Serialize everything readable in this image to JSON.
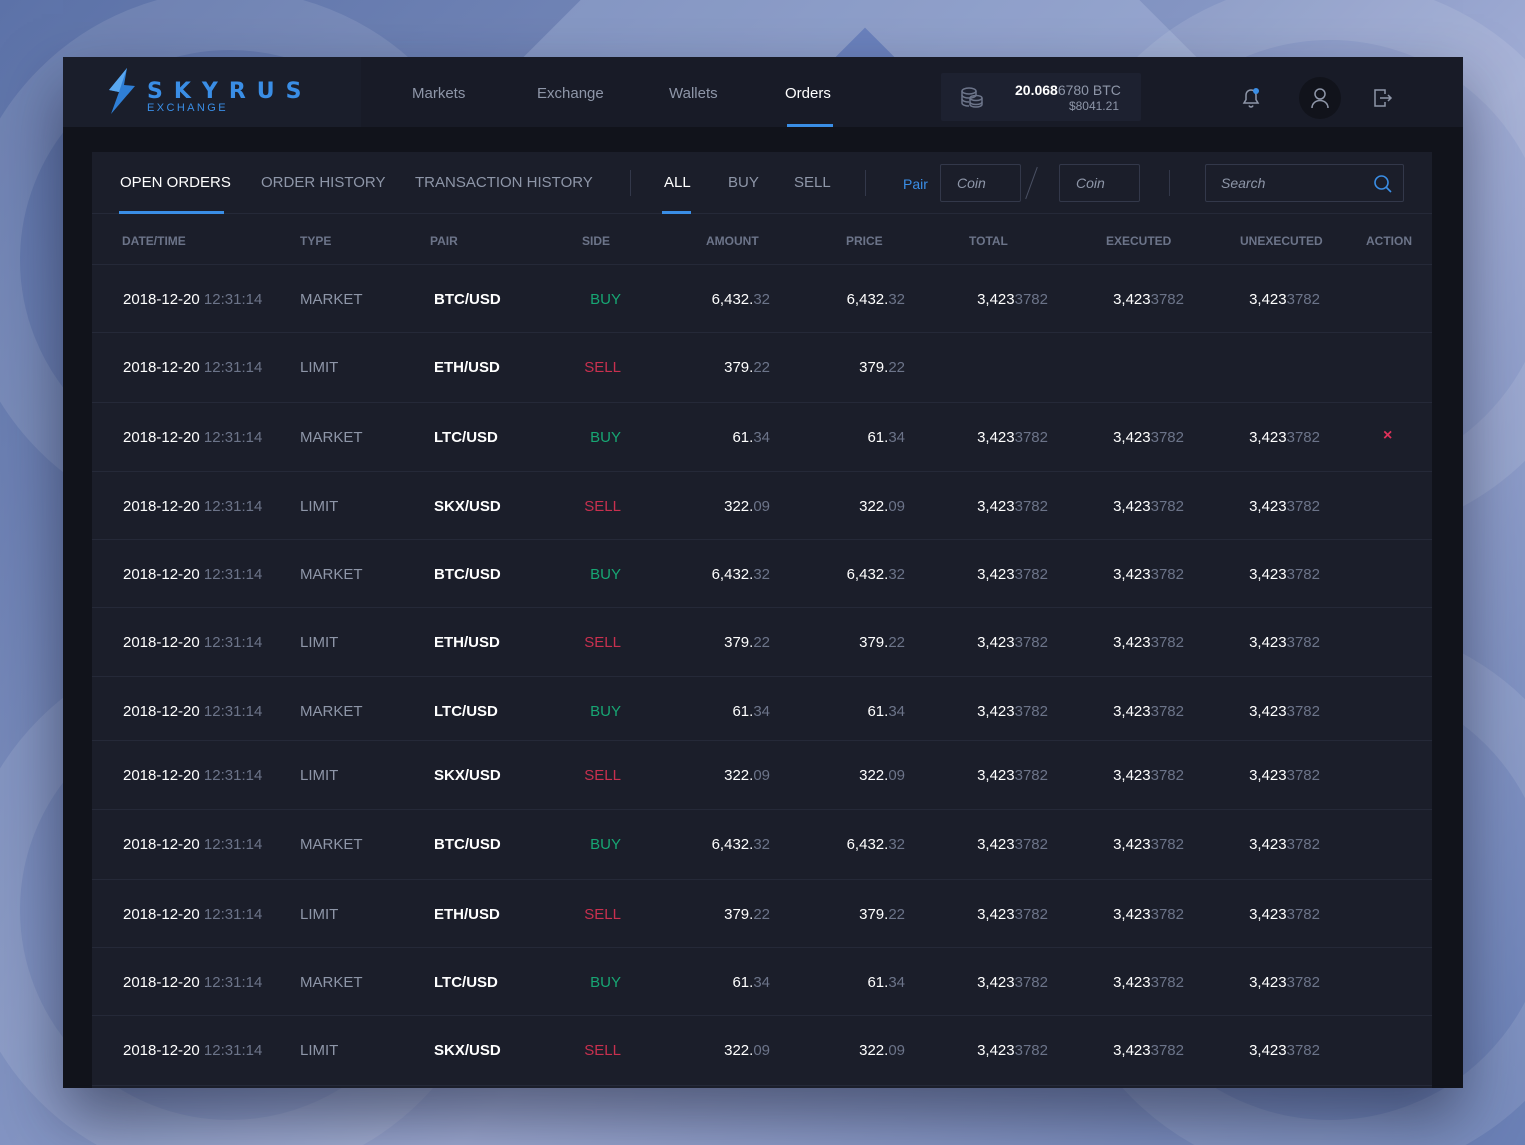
{
  "brand": {
    "name": "SKYRUS",
    "subtitle": "EXCHANGE"
  },
  "nav": [
    "Markets",
    "Exchange",
    "Wallets",
    "Orders"
  ],
  "nav_active": "Orders",
  "balance": {
    "btc_main": "20.068",
    "btc_decimals": "6780",
    "btc_unit": "BTC",
    "usd": "$8041.21"
  },
  "tabs": [
    "OPEN ORDERS",
    "ORDER HISTORY",
    "TRANSACTION HISTORY"
  ],
  "tab_active": "OPEN ORDERS",
  "side_filters": [
    "ALL",
    "BUY",
    "SELL"
  ],
  "side_filter_active": "ALL",
  "pair_filter": {
    "label": "Pair",
    "coin1_placeholder": "Coin",
    "coin2_placeholder": "Coin"
  },
  "search": {
    "placeholder": "Search"
  },
  "columns": [
    "DATE/TIME",
    "TYPE",
    "PAIR",
    "SIDE",
    "AMOUNT",
    "PRICE",
    "TOTAL",
    "EXECUTED",
    "UNEXECUTED",
    "ACTION"
  ],
  "colors": {
    "accent": "#3a8ee6",
    "buy": "#17a673",
    "sell": "#c8304f",
    "cancel": "#e0315a"
  },
  "rows": [
    {
      "date": "2018-12-20",
      "time": "12:31:14",
      "type": "MARKET",
      "pair": "BTC/USD",
      "side": "BUY",
      "amount_int": "6,432.",
      "amount_frac": "32",
      "price_int": "6,432.",
      "price_frac": "32",
      "total_int": "3,423",
      "total_frac": "3782",
      "exec_int": "3,423",
      "exec_frac": "3782",
      "unexec_int": "3,423",
      "unexec_frac": "3782",
      "action": ""
    },
    {
      "date": "2018-12-20",
      "time": "12:31:14",
      "type": "LIMIT",
      "pair": "ETH/USD",
      "side": "SELL",
      "amount_int": "379.",
      "amount_frac": "22",
      "price_int": "379.",
      "price_frac": "22",
      "total_int": "",
      "total_frac": "",
      "exec_int": "",
      "exec_frac": "",
      "unexec_int": "",
      "unexec_frac": "",
      "action": ""
    },
    {
      "date": "2018-12-20",
      "time": "12:31:14",
      "type": "MARKET",
      "pair": "LTC/USD",
      "side": "BUY",
      "amount_int": "61.",
      "amount_frac": "34",
      "price_int": "61.",
      "price_frac": "34",
      "total_int": "3,423",
      "total_frac": "3782",
      "exec_int": "3,423",
      "exec_frac": "3782",
      "unexec_int": "3,423",
      "unexec_frac": "3782",
      "action": "×"
    },
    {
      "date": "2018-12-20",
      "time": "12:31:14",
      "type": "LIMIT",
      "pair": "SKX/USD",
      "side": "SELL",
      "amount_int": "322.",
      "amount_frac": "09",
      "price_int": "322.",
      "price_frac": "09",
      "total_int": "3,423",
      "total_frac": "3782",
      "exec_int": "3,423",
      "exec_frac": "3782",
      "unexec_int": "3,423",
      "unexec_frac": "3782",
      "action": ""
    },
    {
      "date": "2018-12-20",
      "time": "12:31:14",
      "type": "MARKET",
      "pair": "BTC/USD",
      "side": "BUY",
      "amount_int": "6,432.",
      "amount_frac": "32",
      "price_int": "6,432.",
      "price_frac": "32",
      "total_int": "3,423",
      "total_frac": "3782",
      "exec_int": "3,423",
      "exec_frac": "3782",
      "unexec_int": "3,423",
      "unexec_frac": "3782",
      "action": ""
    },
    {
      "date": "2018-12-20",
      "time": "12:31:14",
      "type": "LIMIT",
      "pair": "ETH/USD",
      "side": "SELL",
      "amount_int": "379.",
      "amount_frac": "22",
      "price_int": "379.",
      "price_frac": "22",
      "total_int": "3,423",
      "total_frac": "3782",
      "exec_int": "3,423",
      "exec_frac": "3782",
      "unexec_int": "3,423",
      "unexec_frac": "3782",
      "action": ""
    },
    {
      "date": "2018-12-20",
      "time": "12:31:14",
      "type": "MARKET",
      "pair": "LTC/USD",
      "side": "BUY",
      "amount_int": "61.",
      "amount_frac": "34",
      "price_int": "61.",
      "price_frac": "34",
      "total_int": "3,423",
      "total_frac": "3782",
      "exec_int": "3,423",
      "exec_frac": "3782",
      "unexec_int": "3,423",
      "unexec_frac": "3782",
      "action": ""
    },
    {
      "date": "2018-12-20",
      "time": "12:31:14",
      "type": "LIMIT",
      "pair": "SKX/USD",
      "side": "SELL",
      "amount_int": "322.",
      "amount_frac": "09",
      "price_int": "322.",
      "price_frac": "09",
      "total_int": "3,423",
      "total_frac": "3782",
      "exec_int": "3,423",
      "exec_frac": "3782",
      "unexec_int": "3,423",
      "unexec_frac": "3782",
      "action": ""
    },
    {
      "date": "2018-12-20",
      "time": "12:31:14",
      "type": "MARKET",
      "pair": "BTC/USD",
      "side": "BUY",
      "amount_int": "6,432.",
      "amount_frac": "32",
      "price_int": "6,432.",
      "price_frac": "32",
      "total_int": "3,423",
      "total_frac": "3782",
      "exec_int": "3,423",
      "exec_frac": "3782",
      "unexec_int": "3,423",
      "unexec_frac": "3782",
      "action": ""
    },
    {
      "date": "2018-12-20",
      "time": "12:31:14",
      "type": "LIMIT",
      "pair": "ETH/USD",
      "side": "SELL",
      "amount_int": "379.",
      "amount_frac": "22",
      "price_int": "379.",
      "price_frac": "22",
      "total_int": "3,423",
      "total_frac": "3782",
      "exec_int": "3,423",
      "exec_frac": "3782",
      "unexec_int": "3,423",
      "unexec_frac": "3782",
      "action": ""
    },
    {
      "date": "2018-12-20",
      "time": "12:31:14",
      "type": "MARKET",
      "pair": "LTC/USD",
      "side": "BUY",
      "amount_int": "61.",
      "amount_frac": "34",
      "price_int": "61.",
      "price_frac": "34",
      "total_int": "3,423",
      "total_frac": "3782",
      "exec_int": "3,423",
      "exec_frac": "3782",
      "unexec_int": "3,423",
      "unexec_frac": "3782",
      "action": ""
    },
    {
      "date": "2018-12-20",
      "time": "12:31:14",
      "type": "LIMIT",
      "pair": "SKX/USD",
      "side": "SELL",
      "amount_int": "322.",
      "amount_frac": "09",
      "price_int": "322.",
      "price_frac": "09",
      "total_int": "3,423",
      "total_frac": "3782",
      "exec_int": "3,423",
      "exec_frac": "3782",
      "unexec_int": "3,423",
      "unexec_frac": "3782",
      "action": ""
    }
  ]
}
